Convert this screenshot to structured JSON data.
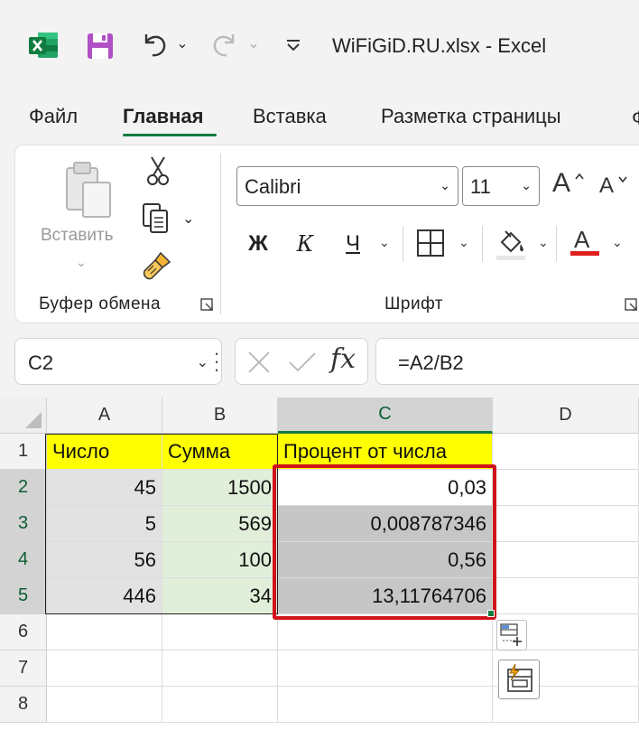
{
  "window": {
    "title": "WiFiGiD.RU.xlsx  -  Excel",
    "undo_dropdown": "⌄",
    "redo_dropdown": "⌄",
    "qat_more": "⌄"
  },
  "tabs": [
    {
      "label": "Файл"
    },
    {
      "label": "Главная",
      "active": true
    },
    {
      "label": "Вставка"
    },
    {
      "label": "Разметка страницы"
    },
    {
      "label": "Ф"
    }
  ],
  "ribbon": {
    "clipboard": {
      "group_label": "Буфер обмена",
      "paste_label": "Вставить",
      "paste_chevron": "⌄",
      "copy_dropdown": "⌄"
    },
    "font": {
      "group_label": "Шрифт",
      "font_name": "Calibri",
      "font_size": "11",
      "dropdown": "⌄",
      "grow_label": "A",
      "shrink_label": "A",
      "bold_label": "Ж",
      "italic_label": "К",
      "underline_label": "Ч",
      "font_color_letter": "A",
      "font_color": "#e01f1f"
    }
  },
  "formula_bar": {
    "name_box": "C2",
    "name_dropdown": "⌄",
    "fx_label": "fx",
    "formula": "=A2/B2"
  },
  "sheet": {
    "columns": [
      "A",
      "B",
      "C",
      "D"
    ],
    "selected_column": "C",
    "rows": [
      "1",
      "2",
      "3",
      "4",
      "5",
      "6",
      "7",
      "8"
    ],
    "selected_rows": [
      "2",
      "3",
      "4",
      "5"
    ],
    "header_row": [
      "Число",
      "Сумма",
      "Процент от числа"
    ],
    "data": [
      [
        "45",
        "1500",
        "0,03"
      ],
      [
        "5",
        "569",
        "0,008787346"
      ],
      [
        "56",
        "100",
        "0,56"
      ],
      [
        "446",
        "34",
        "13,11764706"
      ]
    ],
    "active_cell": "C2",
    "highlight_color": "#d0121b",
    "header_fill": "#ffff00"
  },
  "colors": {
    "accent": "#107c41",
    "background": "#f3f3f3"
  }
}
